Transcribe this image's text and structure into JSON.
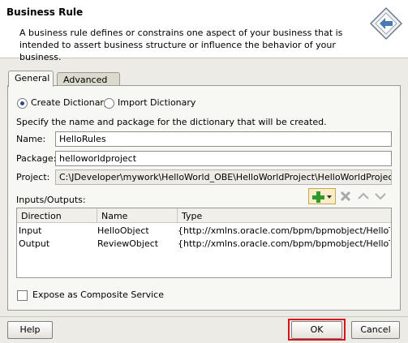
{
  "dialog": {
    "title": "Business Rule",
    "description": "A business rule defines or constrains one aspect of your business that is intended to assert business structure or influence the behavior of your business."
  },
  "tabs": [
    {
      "label": "General",
      "active": true
    },
    {
      "label": "Advanced",
      "active": false
    }
  ],
  "radios": {
    "create": {
      "label": "Create Dictionary",
      "checked": true
    },
    "import": {
      "label": "Import Dictionary",
      "checked": false
    }
  },
  "instruction": "Specify the name and package for the dictionary that will be created.",
  "fields": {
    "name_label": "Name:",
    "name_value": "HelloRules",
    "package_label": "Package:",
    "package_value": "helloworldproject",
    "project_label": "Project:",
    "project_value": "C:\\JDeveloper\\mywork\\HelloWorld_OBE\\HelloWorldProject\\HelloWorldProject.jpr"
  },
  "io": {
    "label": "Inputs/Outputs:",
    "columns": [
      "Direction",
      "Name",
      "Type"
    ],
    "rows": [
      {
        "direction": "Input",
        "name": "HelloObject",
        "type": "{http://xmlns.oracle.com/bpm/bpmobject/HelloTyp..."
      },
      {
        "direction": "Output",
        "name": "ReviewObject",
        "type": "{http://xmlns.oracle.com/bpm/bpmobject/HelloTyp..."
      }
    ]
  },
  "expose": {
    "label": "Expose as Composite Service",
    "checked": false
  },
  "buttons": {
    "help": "Help",
    "ok": "OK",
    "cancel": "Cancel"
  },
  "colors": {
    "highlight": "#d8111a",
    "add_icon": "#2f9a2b"
  }
}
